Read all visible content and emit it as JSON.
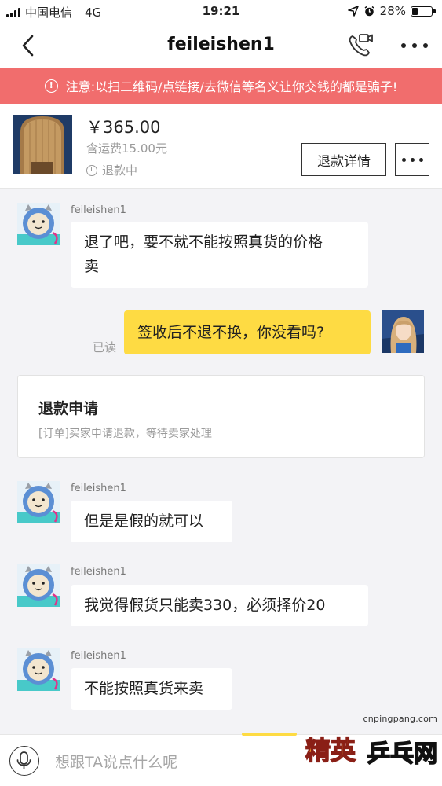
{
  "status_bar": {
    "carrier": "中国电信",
    "network": "4G",
    "time": "19:21",
    "battery_text": "28%",
    "battery_level": 0.28
  },
  "nav": {
    "title": "feileishen1",
    "back_icon": "chevron-left-icon",
    "call_icon": "phone-video-icon",
    "more_icon": "more-dots-icon"
  },
  "warning": {
    "text": "注意:以扫二维码/点链接/去微信等名义让你交钱的都是骗子!",
    "color": "#f16d6d"
  },
  "product": {
    "price": "￥365.00",
    "shipping": "含运费15.00元",
    "status": "退款中",
    "refund_button": "退款详情"
  },
  "messages": [
    {
      "sender": "feileishen1",
      "text_line1": "退了吧，要不就不能按照真货的价格",
      "text_line2": "卖"
    },
    {
      "sender": "me",
      "text": "签收后不退不换，你没看吗?",
      "read": "已读"
    },
    {
      "sender": "feileishen1",
      "text": "但是是假的就可以"
    },
    {
      "sender": "feileishen1",
      "text": "我觉得假货只能卖330，必须择价20"
    },
    {
      "sender": "feileishen1",
      "text": "不能按照真货来卖"
    }
  ],
  "refund_card": {
    "title": "退款申请",
    "desc": "[订单]买家申请退款，等待卖家处理"
  },
  "input": {
    "placeholder": "想跟TA说点什么呢",
    "mic_icon": "microphone-icon"
  },
  "watermark": {
    "url": "cnpingpang.com",
    "logo_left": "精英",
    "logo_right": "乒乓网"
  },
  "colors": {
    "my_bubble": "#fedb43",
    "warning_bar": "#f16d6d"
  }
}
